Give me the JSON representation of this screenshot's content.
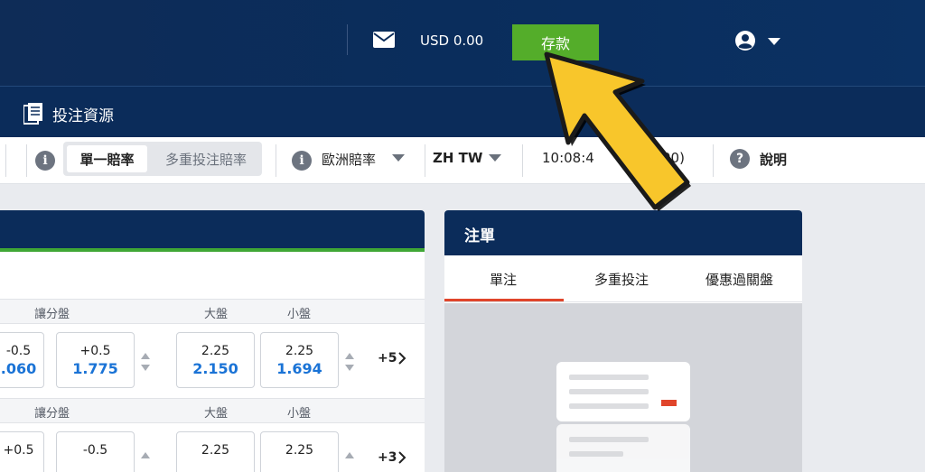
{
  "header": {
    "balance": "USD 0.00",
    "deposit_label": "存款"
  },
  "nav": {
    "bet_resources_label": "投注資源"
  },
  "toolbar": {
    "single_odds_label": "單一賠率",
    "multi_odds_label": "多重投注賠率",
    "odds_format_label": "歐洲賠率",
    "language_label": "ZH TW",
    "time_label": "10:08:4",
    "time_suffix": "00)",
    "help_label": "說明"
  },
  "markets": {
    "rows": [
      {
        "handicap_header": "讓分盤",
        "over_header": "大盤",
        "under_header": "小盤",
        "left_line": "-0.5",
        "left_price": ".060",
        "handicap_line": "+0.5",
        "handicap_price": "1.775",
        "over_line": "2.25",
        "over_price": "2.150",
        "under_line": "2.25",
        "under_price": "1.694",
        "more_label": "+5"
      },
      {
        "handicap_header": "讓分盤",
        "over_header": "大盤",
        "under_header": "小盤",
        "left_line": "+0.5",
        "handicap_line": "-0.5",
        "over_line": "2.25",
        "under_line": "2.25",
        "more_label": "+3"
      }
    ]
  },
  "betslip": {
    "title": "注單",
    "tabs": [
      "單注",
      "多重投注",
      "優惠過關盤"
    ],
    "active_tab": "單注"
  },
  "colors": {
    "header_bg": "#0b2c5a",
    "deposit_green": "#54ad2a",
    "price_blue": "#1a73d6",
    "tab_underline": "#e0452b",
    "arrow_yellow": "#f8c62b"
  }
}
